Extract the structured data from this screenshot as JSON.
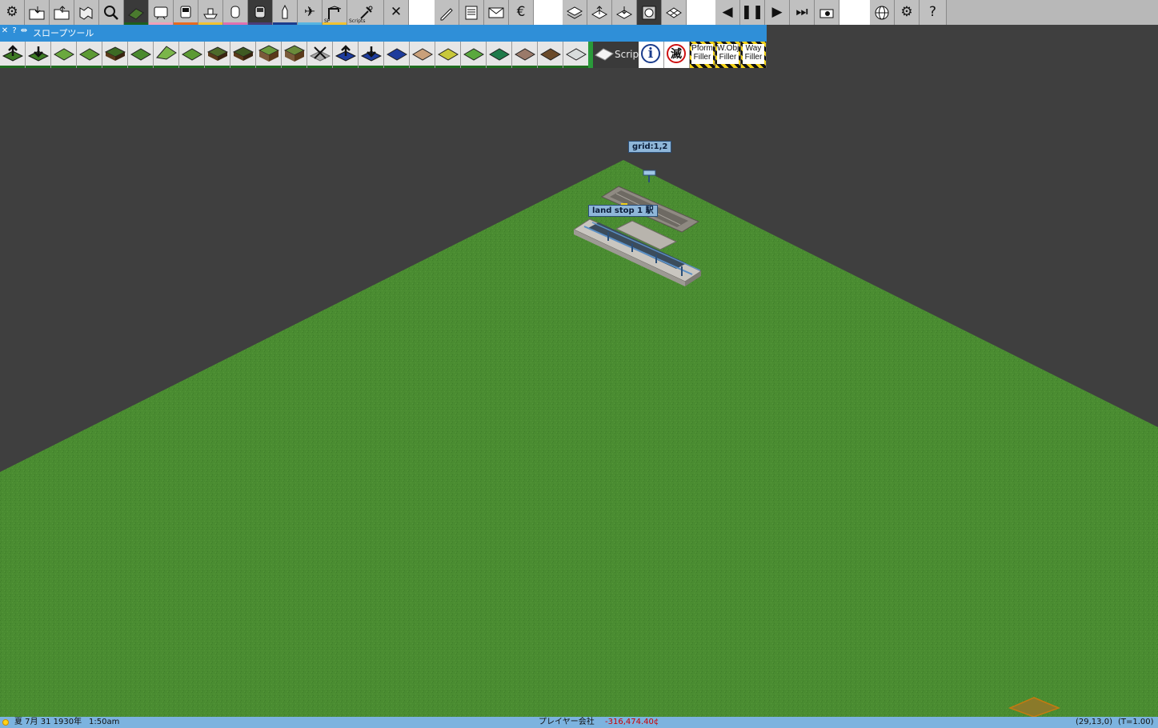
{
  "slope_window": {
    "title": "スロープツール",
    "script_label": "Script",
    "info_glyph": "i",
    "destroy_glyph": "滅",
    "fillers": [
      {
        "line1": "Pform",
        "line2": "Filler"
      },
      {
        "line1": "W.Obj",
        "line2": "Filler"
      },
      {
        "line1": "Way",
        "line2": "Filler"
      }
    ]
  },
  "toolbar": {
    "scripts_label": "Scripts",
    "sp_label": "SP"
  },
  "map": {
    "grid_label": "grid:1,2",
    "station_label": "land stop 1 駅"
  },
  "status": {
    "season_date": "夏 7月 31 1930年",
    "time": "1:50am",
    "player": "プレイヤー会社",
    "money": "-316,474.40¢",
    "coords": "(29,13,0)",
    "speed": "(T=1.00)"
  },
  "colors": {
    "grass": "#4a8c31",
    "void": "#3f3f3f",
    "titlebar": "#2f8fd8",
    "statusbar": "#7cb3df",
    "money_negative": "#cc0000"
  }
}
